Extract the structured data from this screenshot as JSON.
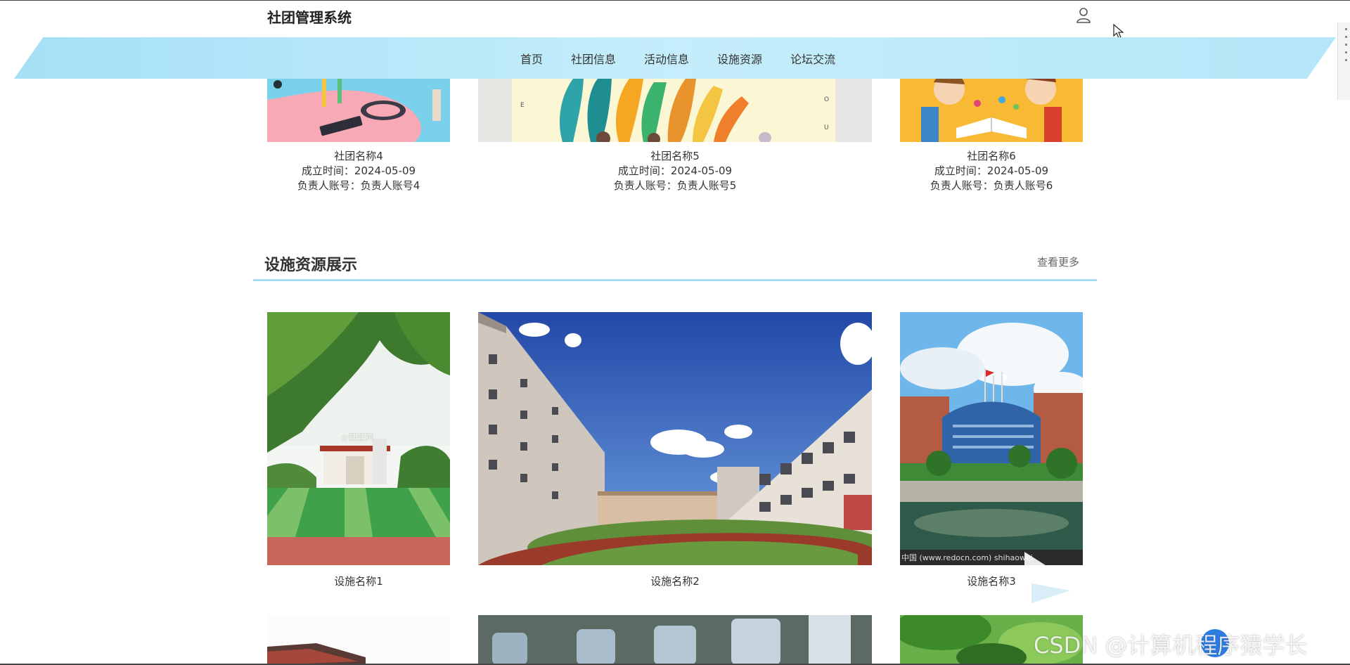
{
  "header": {
    "brand": "社团管理系统",
    "user_icon": "user-icon"
  },
  "nav": {
    "items": [
      "首页",
      "社团信息",
      "活动信息",
      "设施资源",
      "论坛交流"
    ]
  },
  "clubs": [
    {
      "name": "社团名称4",
      "founded": "成立时间：2024-05-09",
      "owner": "负责人账号：负责人账号4"
    },
    {
      "name": "社团名称5",
      "founded": "成立时间：2024-05-09",
      "owner": "负责人账号：负责人账号5"
    },
    {
      "name": "社团名称6",
      "founded": "成立时间：2024-05-09",
      "owner": "负责人账号：负责人账号6"
    }
  ],
  "facilities": {
    "title": "设施资源展示",
    "more": "查看更多",
    "items": [
      {
        "name": "设施名称1",
        "caption": "◎图图网"
      },
      {
        "name": "设施名称2"
      },
      {
        "name": "设施名称3",
        "caption": "中国 (www.redocn.com)    shihaowei"
      }
    ]
  },
  "watermark": "CSDN @计算机程序猿学长",
  "colors": {
    "nav_bg": "#a6e0f6",
    "section_line": "#a6dcf2",
    "watermark_dot": "#2d7de0"
  }
}
